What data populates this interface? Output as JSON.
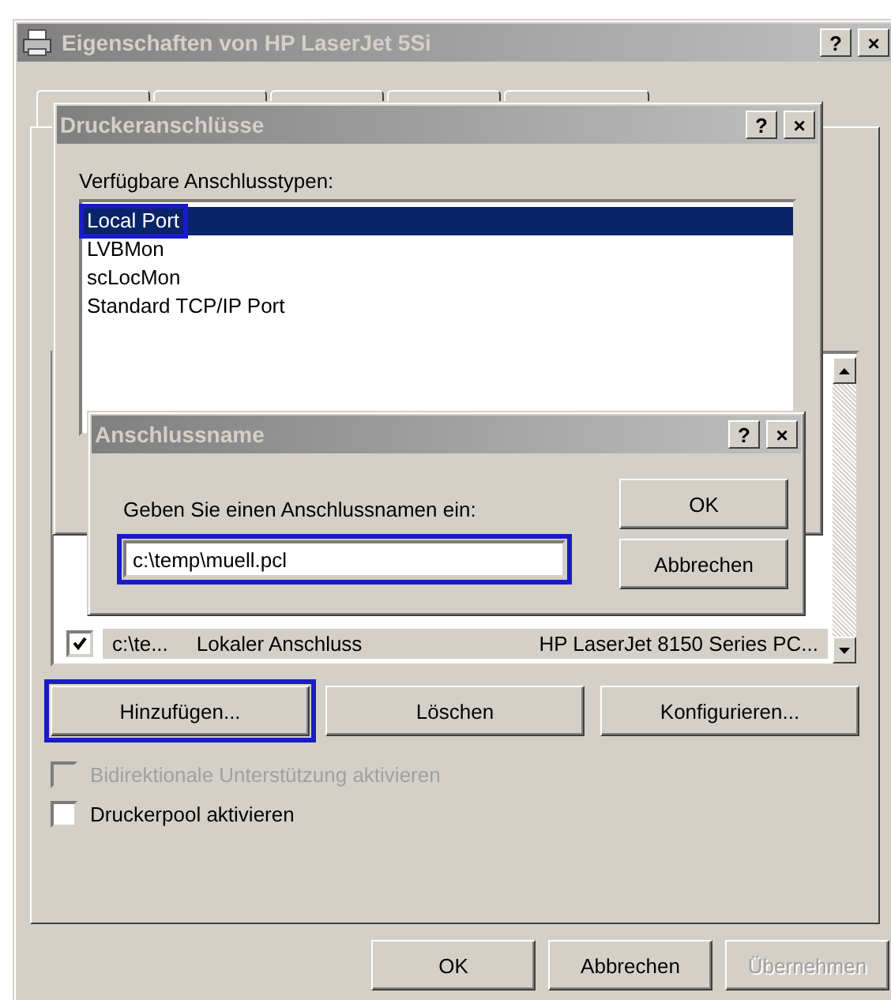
{
  "main_window": {
    "title": "Eigenschaften von HP LaserJet 5Si",
    "title_buttons": [
      "?",
      "×"
    ],
    "port_row": {
      "checked": true,
      "port": "c:\\te...",
      "description": "Lokaler Anschluss",
      "printer": "HP LaserJet 8150 Series PC..."
    },
    "port_buttons": [
      {
        "label": "Hinzufügen...",
        "highlighted": true
      },
      {
        "label": "Löschen",
        "highlighted": false
      },
      {
        "label": "Konfigurieren...",
        "highlighted": false
      }
    ],
    "checkboxes": [
      {
        "label": "Bidirektionale Unterstützung aktivieren",
        "checked": false,
        "disabled": true
      },
      {
        "label": "Druckerpool aktivieren",
        "checked": false,
        "disabled": false
      }
    ],
    "buttons": [
      {
        "label": "OK",
        "disabled": false
      },
      {
        "label": "Abbrechen",
        "disabled": false
      },
      {
        "label": "Übernehmen",
        "disabled": true
      }
    ]
  },
  "ports_dialog": {
    "title": "Druckeranschlüsse",
    "title_buttons": [
      "?",
      "×"
    ],
    "label": "Verfügbare Anschlusstypen:",
    "items": [
      {
        "label": "Local Port",
        "selected": true,
        "highlighted": true
      },
      {
        "label": "LVBMon",
        "selected": false,
        "highlighted": false
      },
      {
        "label": "scLocMon",
        "selected": false,
        "highlighted": false
      },
      {
        "label": "Standard TCP/IP Port",
        "selected": false,
        "highlighted": false
      }
    ]
  },
  "name_dialog": {
    "title": "Anschlussname",
    "title_buttons": [
      "?",
      "×"
    ],
    "label": "Geben Sie einen Anschlussnamen ein:",
    "value": "c:\\temp\\muell.pcl",
    "highlighted": true,
    "buttons": [
      "OK",
      "Abbrechen"
    ]
  }
}
